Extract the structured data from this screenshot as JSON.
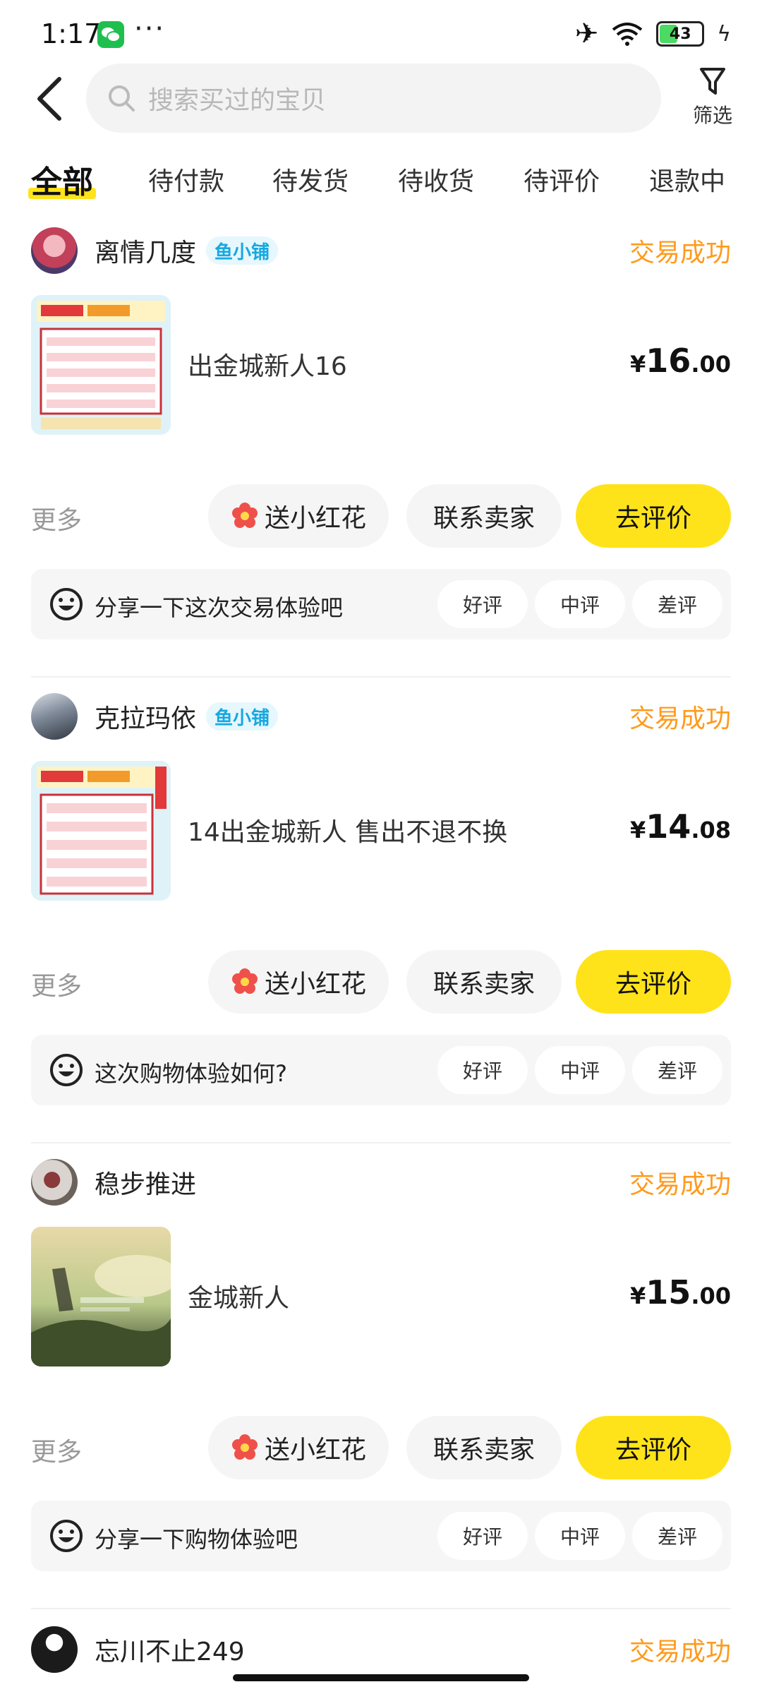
{
  "status_bar": {
    "time": "1:17",
    "more": "···",
    "battery": "43"
  },
  "search": {
    "placeholder": "搜索买过的宝贝"
  },
  "filter": {
    "label": "筛选"
  },
  "tabs": [
    "全部",
    "待付款",
    "待发货",
    "待收货",
    "待评价",
    "退款中"
  ],
  "colors": {
    "accent_yellow": "#ffe31a",
    "status_orange": "#ff9a1c",
    "badge_blue": "#17a8e0"
  },
  "orders": [
    {
      "seller": "离情几度",
      "badge": "鱼小铺",
      "status": "交易成功",
      "title": "出金城新人16",
      "price": {
        "currency": "¥",
        "integer": "16",
        "decimal": ".00"
      },
      "more": "更多",
      "flower": "送小红花",
      "contact": "联系卖家",
      "review": "去评价",
      "feedback": {
        "prompt": "分享一下这次交易体验吧",
        "good": "好评",
        "mid": "中评",
        "bad": "差评"
      }
    },
    {
      "seller": "克拉玛依",
      "badge": "鱼小铺",
      "status": "交易成功",
      "title": "14出金城新人 售出不退不换",
      "price": {
        "currency": "¥",
        "integer": "14",
        "decimal": ".08"
      },
      "more": "更多",
      "flower": "送小红花",
      "contact": "联系卖家",
      "review": "去评价",
      "feedback": {
        "prompt": "这次购物体验如何?",
        "good": "好评",
        "mid": "中评",
        "bad": "差评"
      }
    },
    {
      "seller": "稳步推进",
      "status": "交易成功",
      "title": "金城新人",
      "price": {
        "currency": "¥",
        "integer": "15",
        "decimal": ".00"
      },
      "more": "更多",
      "flower": "送小红花",
      "contact": "联系卖家",
      "review": "去评价",
      "feedback": {
        "prompt": "分享一下购物体验吧",
        "good": "好评",
        "mid": "中评",
        "bad": "差评"
      }
    },
    {
      "seller": "忘川不止249",
      "status": "交易成功"
    }
  ]
}
